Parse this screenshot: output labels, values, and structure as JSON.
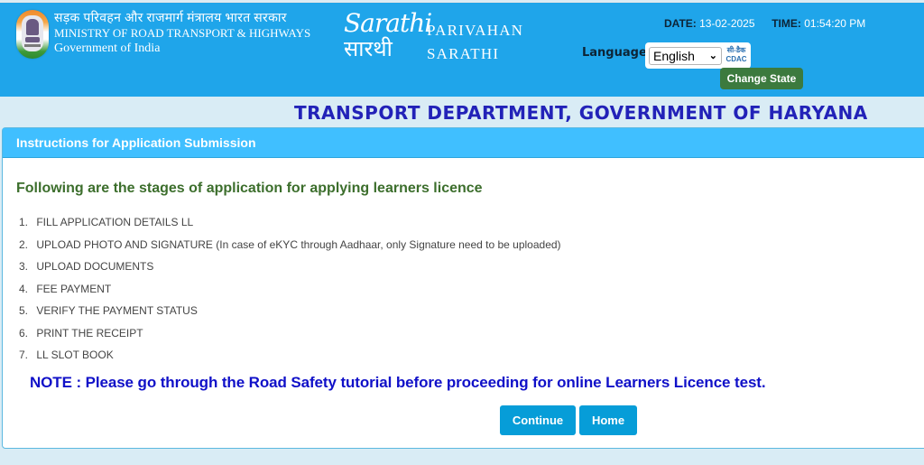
{
  "header": {
    "ministry_hindi": "सड़क परिवहन और राजमार्ग मंत्रालय भारत सरकार",
    "ministry_english": "MINISTRY OF ROAD TRANSPORT & HIGHWAYS",
    "government": "Government of India",
    "logo_en": "Sarathi",
    "logo_hi": "सारथी",
    "app_name_line1": "PARIVAHAN",
    "app_name_line2": "SARATHI",
    "date_label": "DATE:",
    "date_value": "13-02-2025",
    "time_label": "TIME:",
    "time_value": "01:54:20 PM",
    "language_label": "Language:",
    "language_selected": "English",
    "cdac_hi": "सी-डैक",
    "cdac_en": "CDAC",
    "change_state_label": "Change State"
  },
  "department_title": "TRANSPORT DEPARTMENT, GOVERNMENT OF HARYANA",
  "panel": {
    "heading": "Instructions for Application Submission",
    "stages_title": "Following are the stages of application for applying learners licence",
    "stages": [
      {
        "num": "1.",
        "text": "FILL APPLICATION DETAILS LL"
      },
      {
        "num": "2.",
        "text": "UPLOAD PHOTO AND SIGNATURE (In case of eKYC through Aadhaar, only Signature need to be uploaded)"
      },
      {
        "num": "3.",
        "text": "UPLOAD DOCUMENTS"
      },
      {
        "num": "4.",
        "text": "FEE PAYMENT"
      },
      {
        "num": "5.",
        "text": "VERIFY THE PAYMENT STATUS"
      },
      {
        "num": "6.",
        "text": "PRINT THE RECEIPT"
      },
      {
        "num": "7.",
        "text": "LL SLOT BOOK"
      }
    ],
    "note": "NOTE : Please go through the Road Safety tutorial before proceeding for online Learners Licence test.",
    "continue_label": "Continue",
    "home_label": "Home"
  }
}
